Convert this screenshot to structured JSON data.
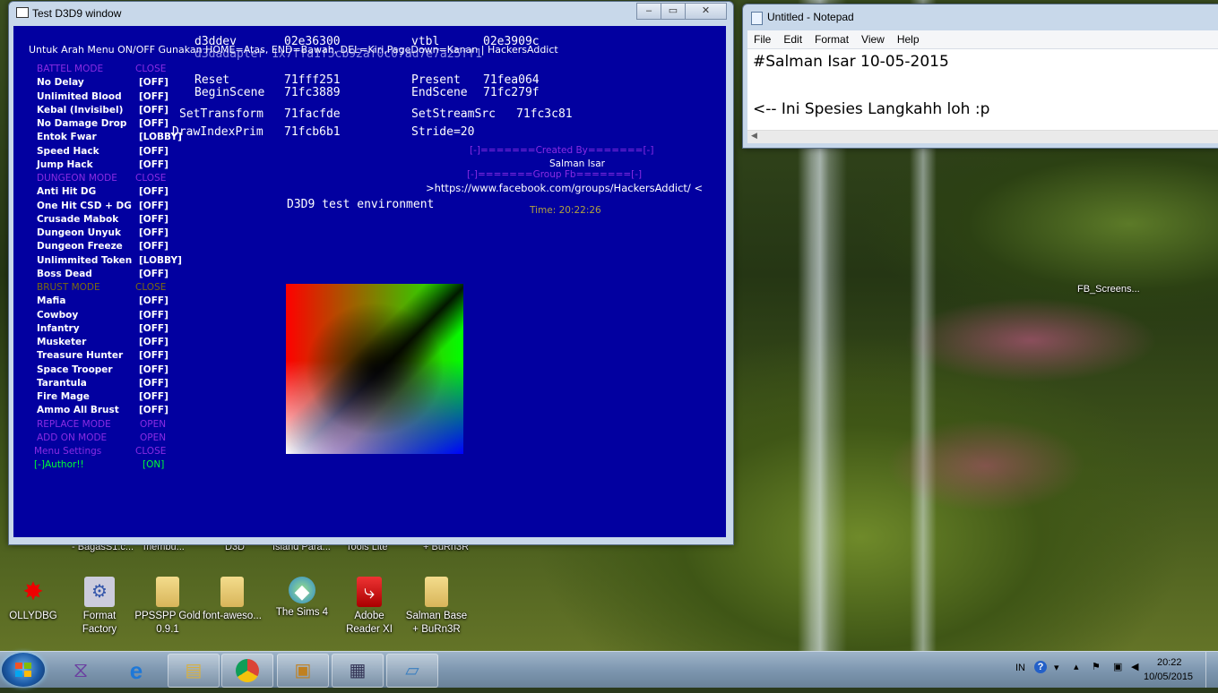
{
  "desktop": {
    "partial_labels": [
      "- BagasS1.c...",
      "membu...",
      "D3D",
      "Island Para...",
      "Tools Lite",
      "+ BuRn3R"
    ],
    "right_label": "FB_Screens...",
    "icons": [
      {
        "label1": "OLLYDBG",
        "label2": "",
        "icon": "bug-icon"
      },
      {
        "label1": "Format",
        "label2": "Factory",
        "icon": "format-factory-icon"
      },
      {
        "label1": "PPSSPP Gold",
        "label2": "0.9.1",
        "icon": "folder-icon"
      },
      {
        "label1": "font-aweso...",
        "label2": "",
        "icon": "folder-icon"
      },
      {
        "label1": "The Sims 4",
        "label2": "",
        "icon": "sims-icon"
      },
      {
        "label1": "Adobe",
        "label2": "Reader XI",
        "icon": "pdf-icon"
      },
      {
        "label1": "Salman Base",
        "label2": "+ BuRn3R",
        "icon": "folder-icon"
      }
    ]
  },
  "d3d_window": {
    "title": "Test D3D9 window",
    "minimize": "–",
    "maximize": "▭",
    "close": "✕",
    "header_note": "Untuk Arah Menu ON/OFF Gunakan HOME=Atas, END=Bawah, DEL=Kiri,PageDown=Kanan | HackersAddict",
    "menu": [
      {
        "label": "BATTEL MODE",
        "value": "CLOSE",
        "kind": "section"
      },
      {
        "label": "No Delay",
        "value": "[OFF]",
        "kind": "item"
      },
      {
        "label": "Unlimited Blood",
        "value": "[OFF]",
        "kind": "item"
      },
      {
        "label": "Kebal (Invisibel)",
        "value": "[OFF]",
        "kind": "item"
      },
      {
        "label": "No Damage Drop",
        "value": "[OFF]",
        "kind": "item"
      },
      {
        "label": "Entok Fwar",
        "value": "[LOBBY]",
        "kind": "item"
      },
      {
        "label": "Speed Hack",
        "value": "[OFF]",
        "kind": "item"
      },
      {
        "label": "Jump Hack",
        "value": "[OFF]",
        "kind": "item"
      },
      {
        "label": "DUNGEON MODE",
        "value": "CLOSE",
        "kind": "section"
      },
      {
        "label": "Anti Hit DG",
        "value": "[OFF]",
        "kind": "item"
      },
      {
        "label": "One Hit CSD + DG",
        "value": "[OFF]",
        "kind": "item"
      },
      {
        "label": "Crusade Mabok",
        "value": "[OFF]",
        "kind": "item"
      },
      {
        "label": "Dungeon Unyuk",
        "value": "[OFF]",
        "kind": "item"
      },
      {
        "label": "Dungeon Freeze",
        "value": "[OFF]",
        "kind": "item"
      },
      {
        "label": "Unlimmited Token",
        "value": "[LOBBY]",
        "kind": "item"
      },
      {
        "label": "Boss Dead",
        "value": "[OFF]",
        "kind": "item"
      },
      {
        "label": "BRUST MODE",
        "value": "CLOSE",
        "kind": "section-dim"
      },
      {
        "label": "Mafia",
        "value": "[OFF]",
        "kind": "item"
      },
      {
        "label": "Cowboy",
        "value": "[OFF]",
        "kind": "item"
      },
      {
        "label": "Infantry",
        "value": "[OFF]",
        "kind": "item"
      },
      {
        "label": "Musketer",
        "value": "[OFF]",
        "kind": "item"
      },
      {
        "label": "Treasure Hunter",
        "value": "[OFF]",
        "kind": "item"
      },
      {
        "label": "Space Trooper",
        "value": "[OFF]",
        "kind": "item"
      },
      {
        "label": "Tarantula",
        "value": "[OFF]",
        "kind": "item"
      },
      {
        "label": "Fire Mage",
        "value": "[OFF]",
        "kind": "item"
      },
      {
        "label": "Ammo All Brust",
        "value": "[OFF]",
        "kind": "item"
      },
      {
        "label": "REPLACE MODE",
        "value": "OPEN",
        "kind": "section"
      },
      {
        "label": "ADD ON MODE",
        "value": "OPEN",
        "kind": "section"
      },
      {
        "label": "Menu Settings",
        "value": "CLOSE",
        "kind": "section"
      },
      {
        "label": "[-]Author!!",
        "value": "[ON]",
        "kind": "active"
      }
    ],
    "debug": {
      "d3ddev_label": "d3ddev",
      "d3ddev_value": "02e36300",
      "vtbl_label": "vtbl",
      "vtbl_value": "02e3909c",
      "adapter_line": "d3dadapter 1x7ffa1f5cb92af0c07ad7e7a25ff1",
      "reset_label": "Reset",
      "reset_value": "71fff251",
      "present_label": "Present",
      "present_value": "71fea064",
      "beginscene_label": "BeginScene",
      "beginscene_value": "71fc3889",
      "endscene_label": "EndScene",
      "endscene_value": "71fc279f",
      "settransform_label": "SetTransform",
      "settransform_value": "71facfde",
      "setstreamsrc_label": "SetStreamSrc",
      "setstreamsrc_value": "71fc3c81",
      "drawindex_label": "DrawIndexPrim",
      "drawindex_value": "71fcb6b1",
      "stride_label": "Stride=20"
    },
    "credits": {
      "line1": "[-]=======Created By=======[-]",
      "name": "Salman Isar",
      "line2": "[-]=======Group Fb=======[-]",
      "url": ">https://www.facebook.com/groups/HackersAddict/ <",
      "time": "Time: 20:22:26"
    },
    "env_label": "D3D9 test environment"
  },
  "notepad": {
    "title": "Untitled - Notepad",
    "menu": [
      "File",
      "Edit",
      "Format",
      "View",
      "Help"
    ],
    "line1": "#Salman Isar 10-05-2015",
    "line2": "<-- Ini Spesies Langkahh loh :p"
  },
  "taskbar": {
    "lang": "IN",
    "time": "20:22",
    "date": "10/05/2015",
    "apps": [
      "visual-studio-icon",
      "internet-explorer-icon",
      "explorer-icon",
      "chrome-icon",
      "paint-icon",
      "document-icon",
      "notepad-icon"
    ]
  },
  "colors": {
    "client_bg": "#0200a0",
    "menu_item": "#ffffff",
    "menu_section": "#8a2be2",
    "menu_section_dim": "#7a6a10",
    "menu_active": "#00ff33",
    "credits": "#8a2be2",
    "time": "#b0a040"
  }
}
